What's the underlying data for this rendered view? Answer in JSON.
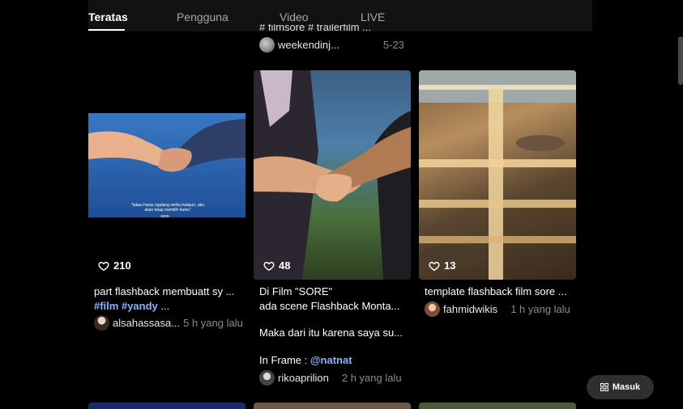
{
  "tabs": [
    {
      "label": "Teratas"
    },
    {
      "label": "Pengguna"
    },
    {
      "label": "Video"
    },
    {
      "label": "LIVE"
    }
  ],
  "above_card": {
    "caption": "# filmsore # trailerfilm ...",
    "author": "weekendinj...",
    "time": "5-23"
  },
  "cards": [
    {
      "likes": "210",
      "overlay_text": "\"kalau harus ngulang seribu kalipun, aku akan tetap memilih kamu\"",
      "overlay_sub": "-sore-",
      "caption": "part flashback membuatt sy ...",
      "tags": [
        "#film",
        "#yandy",
        "..."
      ],
      "author": "alsahassasa...",
      "time": "5 h yang lalu"
    },
    {
      "likes": "48",
      "caption_lines": [
        "Di Film \"SORE\"",
        "ada scene Flashback Monta...",
        "",
        "Maka dari itu karena saya su...",
        ""
      ],
      "in_frame_label": "In Frame :",
      "in_frame_tag": "@natnat",
      "author": "rikoaprilion",
      "time": "2 h yang lalu"
    },
    {
      "likes": "13",
      "caption": "template flashback film sore ...",
      "author": "fahmidwikis",
      "time": "1 h yang lalu"
    }
  ],
  "login_button": {
    "label": "Masuk",
    "icon": "grid-icon"
  },
  "icons": {
    "like": "heart-icon"
  }
}
